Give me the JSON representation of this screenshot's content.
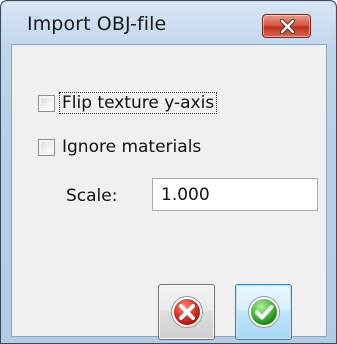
{
  "window": {
    "title": "Import OBJ-file"
  },
  "options": {
    "flip_texture_label": "Flip texture y-axis",
    "flip_texture_checked": false,
    "ignore_materials_label": "Ignore materials",
    "ignore_materials_checked": false
  },
  "scale": {
    "label": "Scale:",
    "value": "1.000"
  },
  "buttons": {
    "cancel_icon": "cancel-icon",
    "ok_icon": "checkmark-icon"
  },
  "colors": {
    "close_button": "#c7371f",
    "cancel_red": "#d9362b",
    "ok_green": "#3fae3b"
  }
}
